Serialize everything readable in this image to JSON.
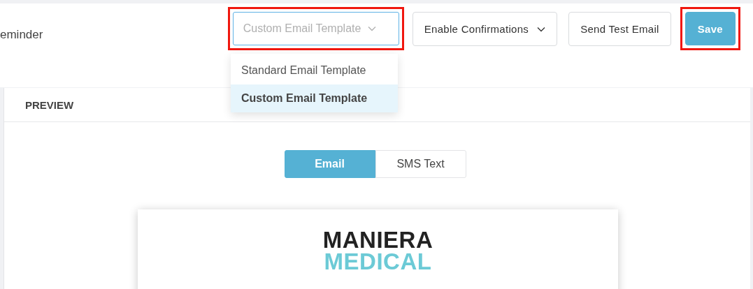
{
  "header": {
    "title": "eminder",
    "template_select": {
      "value": "Custom Email Template",
      "expanded": true,
      "highlighted": true,
      "options": [
        {
          "label": "Standard Email Template",
          "selected": false
        },
        {
          "label": "Custom Email Template",
          "selected": true
        }
      ]
    },
    "buttons": [
      {
        "kind": "dropdown",
        "label": "Enable Confirmations",
        "highlighted": false
      },
      {
        "kind": "plain",
        "label": "Send Test Email",
        "highlighted": false
      },
      {
        "kind": "primary",
        "label": "Save",
        "highlighted": true
      }
    ]
  },
  "preview": {
    "heading": "PREVIEW",
    "tabs": [
      {
        "label": "Email",
        "selected": true
      },
      {
        "label": "SMS Text",
        "selected": false
      }
    ],
    "email": {
      "logo_line_1": "MANIERA",
      "logo_line_2": "MEDICAL"
    }
  }
}
